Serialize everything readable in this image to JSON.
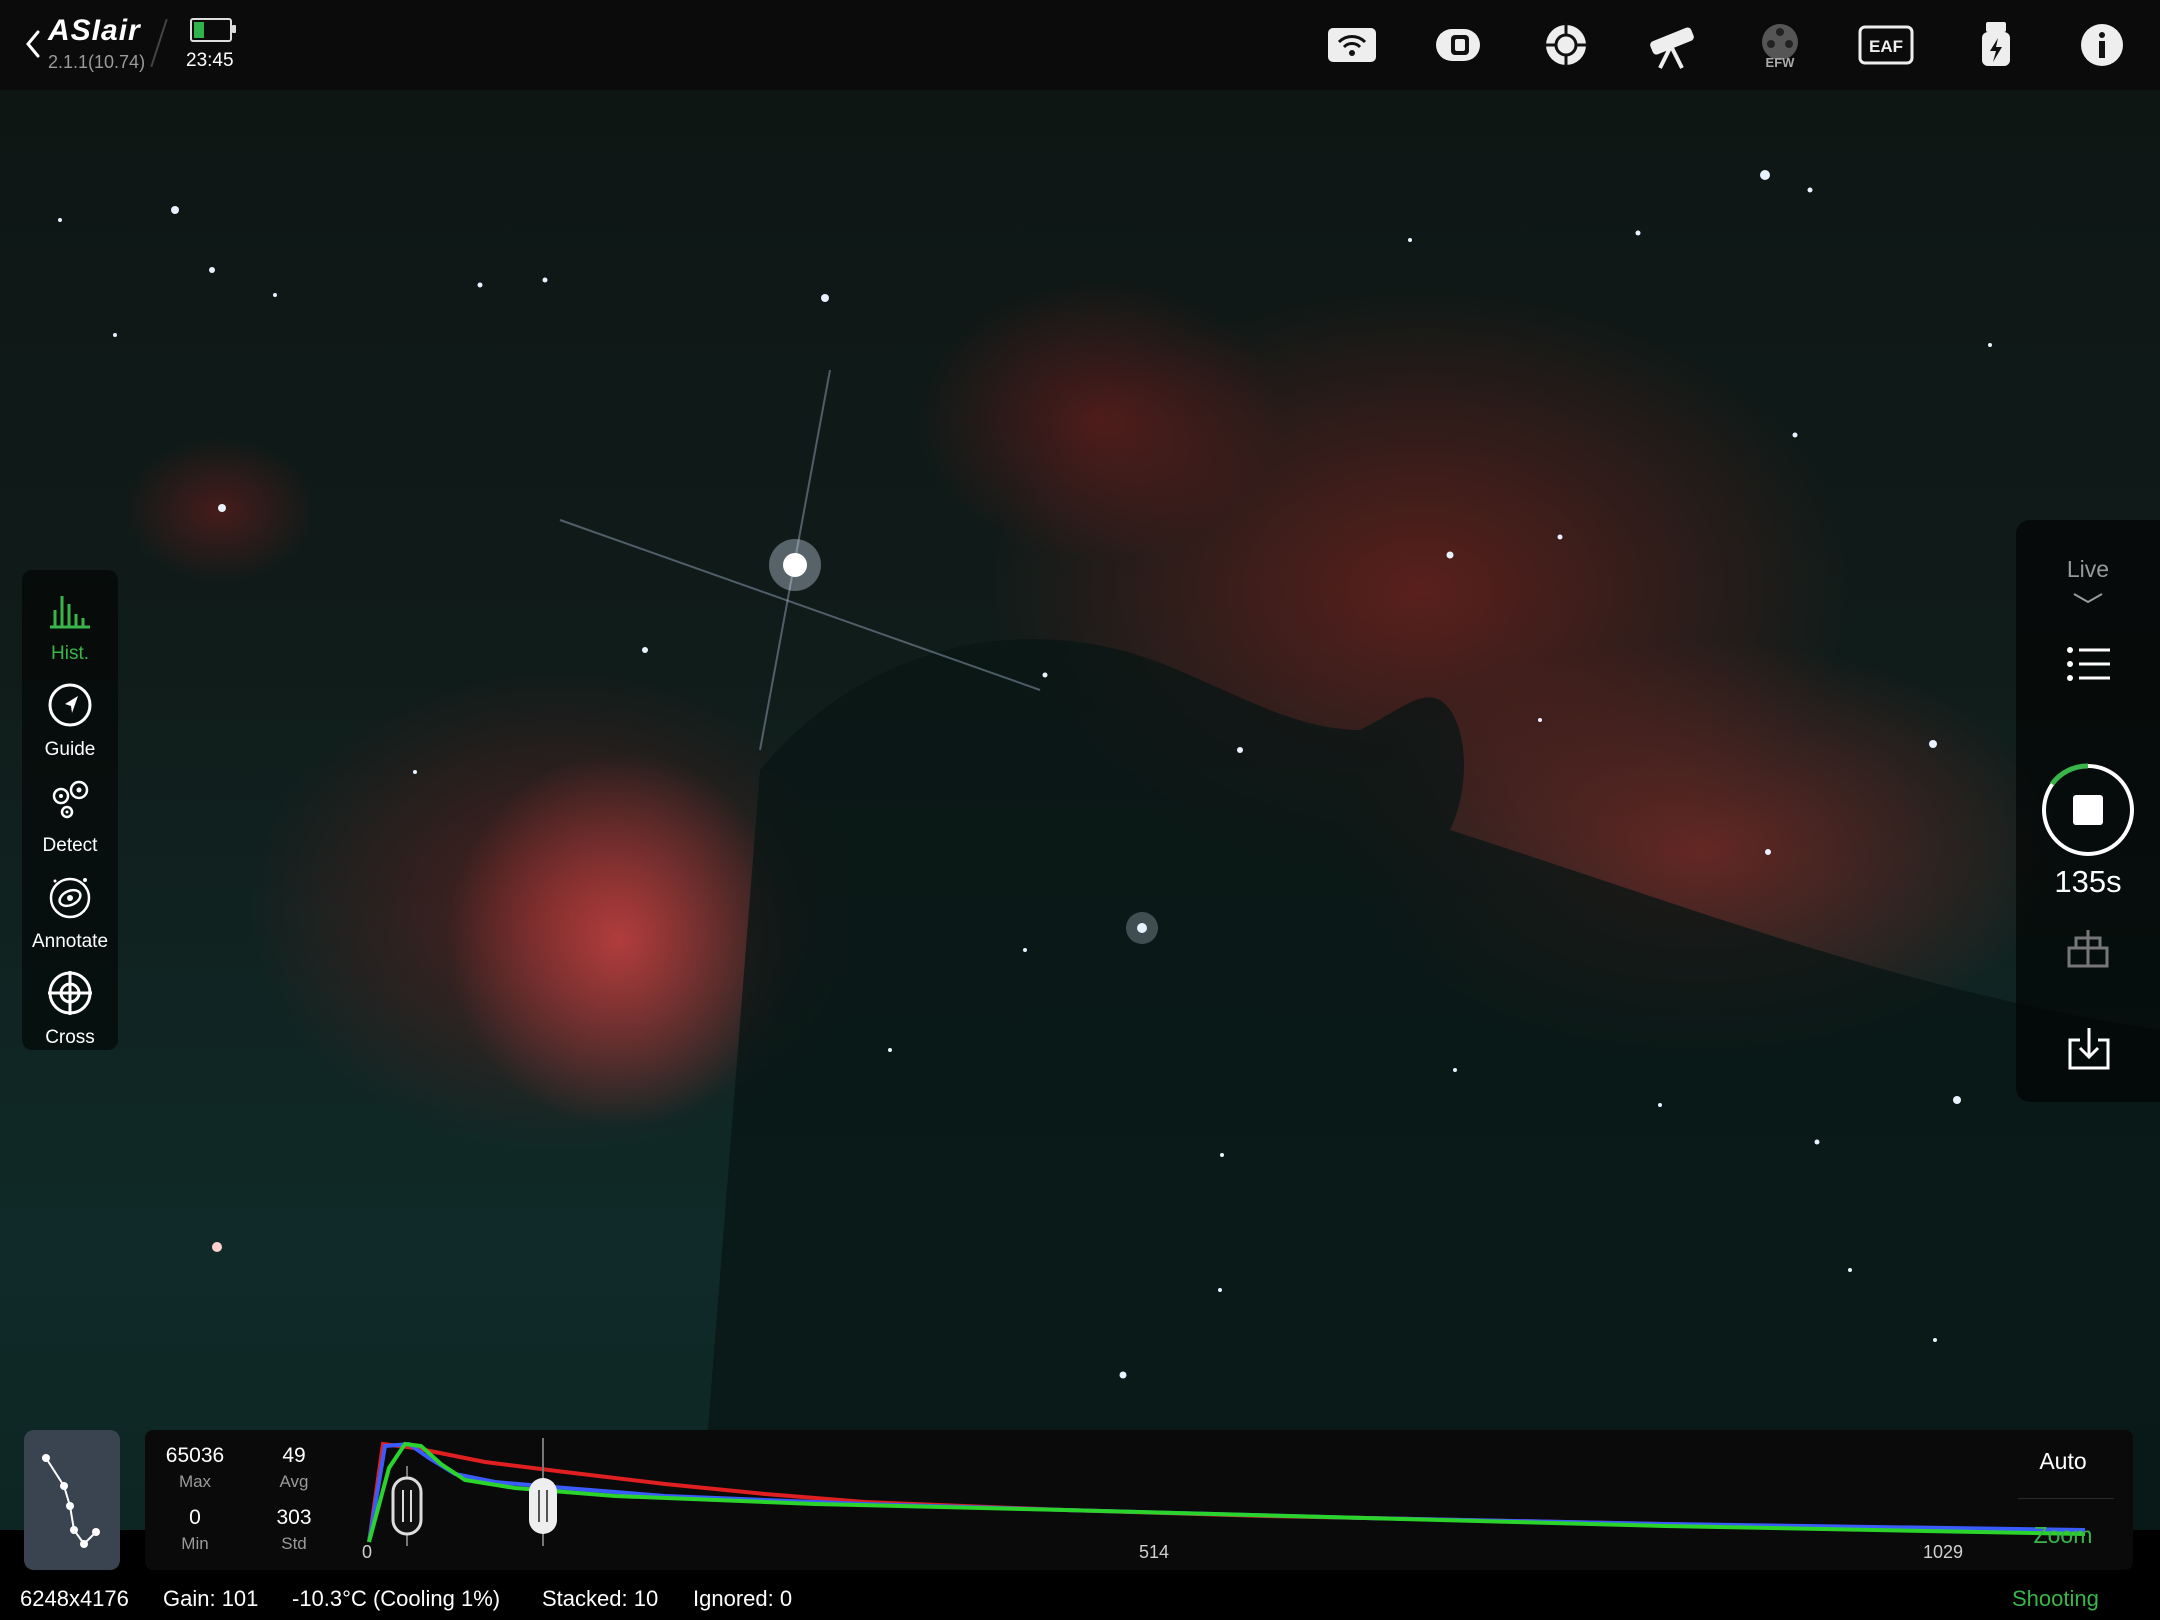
{
  "app": {
    "brand": "ASIair",
    "version": "2.1.1(10.74)",
    "time": "23:45",
    "battery_color": "#2fb34a"
  },
  "toolbar_icons": [
    "wifi-icon",
    "camera-icon",
    "guide-camera-icon",
    "telescope-icon",
    "efw-icon",
    "eaf-icon",
    "usb-power-icon",
    "info-icon"
  ],
  "toolbar_labels": {
    "efw": "EFW",
    "eaf": "EAF"
  },
  "left_tools": [
    {
      "label": "Hist.",
      "icon": "histogram-icon",
      "active": true
    },
    {
      "label": "Guide",
      "icon": "compass-icon",
      "active": false
    },
    {
      "label": "Detect",
      "icon": "star-detect-icon",
      "active": false
    },
    {
      "label": "Annotate",
      "icon": "galaxy-icon",
      "active": false
    },
    {
      "label": "Cross",
      "icon": "crosshair-icon",
      "active": false
    }
  ],
  "right_panel": {
    "mode": "Live",
    "exposure": "135s",
    "accent": "#39b54a"
  },
  "histogram": {
    "max_value": "65036",
    "max_label": "Max",
    "avg_value": "49",
    "avg_label": "Avg",
    "min_value": "0",
    "min_label": "Min",
    "std_value": "303",
    "std_label": "Std",
    "axis": [
      "0",
      "514",
      "1029"
    ],
    "auto_label": "Auto",
    "zoom_label": "Zoom"
  },
  "status": {
    "resolution": "6248x4176",
    "gain": "Gain: 101",
    "temperature": "-10.3°C (Cooling 1%)",
    "stacked": "Stacked: 10",
    "ignored": "Ignored: 0",
    "mode": "Shooting"
  }
}
